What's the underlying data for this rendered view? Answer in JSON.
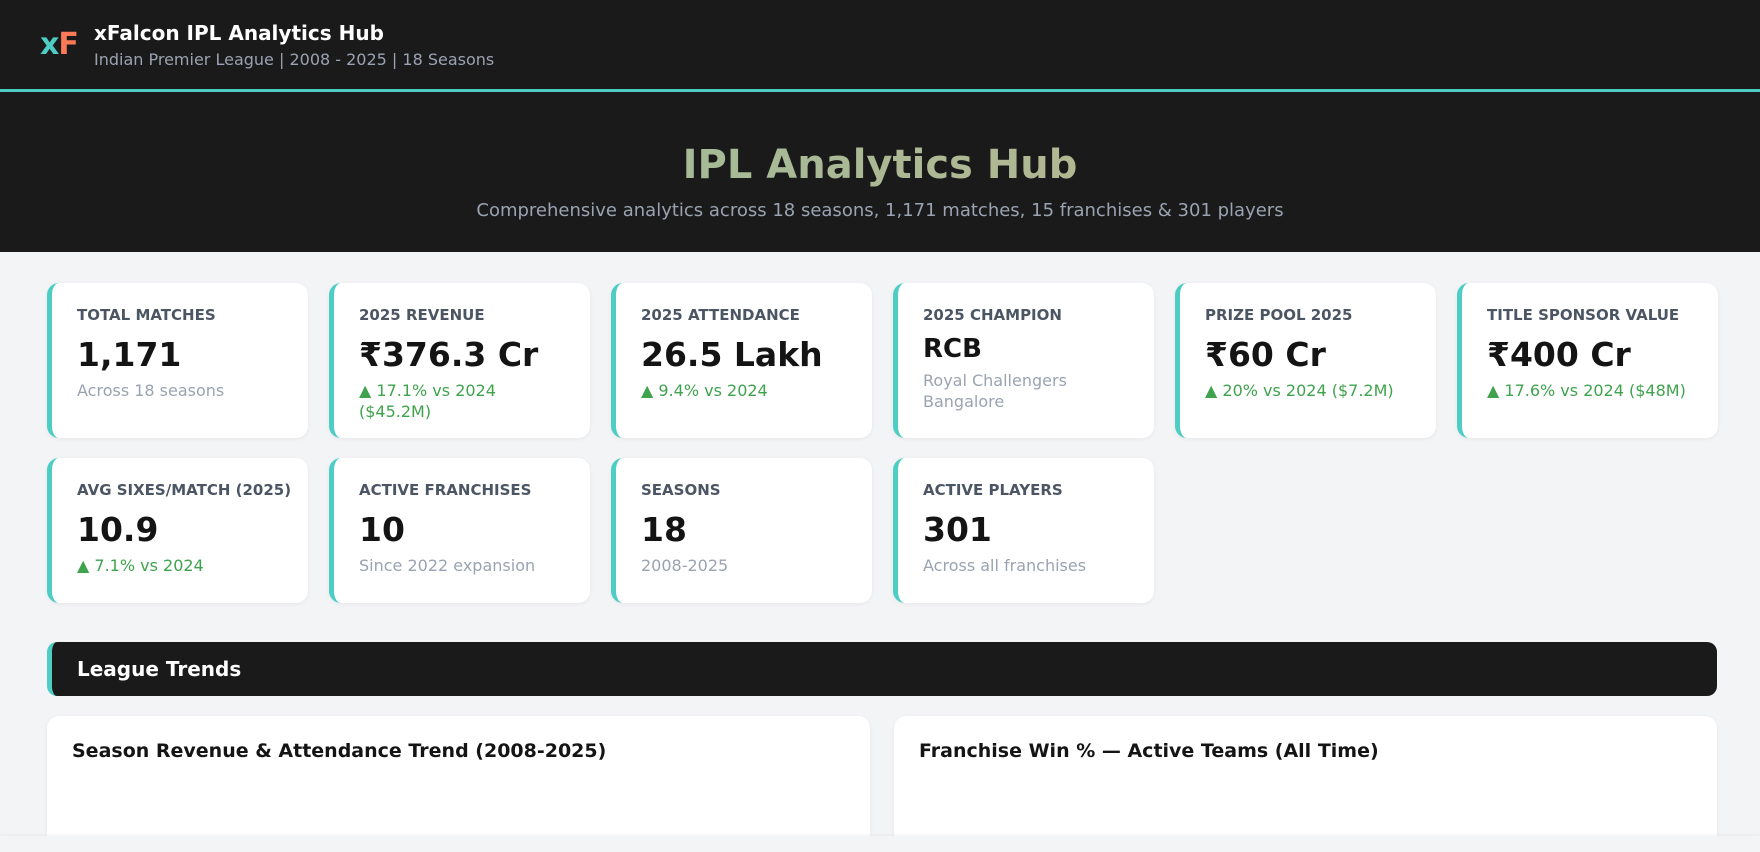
{
  "header": {
    "logo_x": "x",
    "logo_f": "F",
    "title": "xFalcon IPL Analytics Hub",
    "subtitle": "Indian Premier League | 2008 - 2025 | 18 Seasons"
  },
  "hero": {
    "title": "IPL Analytics Hub",
    "subtitle": "Comprehensive analytics across 18 seasons, 1,171 matches, 15 franchises & 301 players"
  },
  "stats": [
    {
      "label": "TOTAL MATCHES",
      "value": "1,171",
      "note": "Across 18 seasons"
    },
    {
      "label": "2025 REVENUE",
      "value": "₹376.3 Cr",
      "note": "▲ 17.1% vs 2024 ($45.2M)"
    },
    {
      "label": "2025 ATTENDANCE",
      "value": "26.5 Lakh",
      "note": "▲ 9.4% vs 2024"
    },
    {
      "label": "2025 CHAMPION",
      "value": "RCB",
      "note": "Royal Challengers Bangalore"
    },
    {
      "label": "PRIZE POOL 2025",
      "value": "₹60 Cr",
      "note": "▲ 20% vs 2024 ($7.2M)"
    },
    {
      "label": "TITLE SPONSOR VALUE",
      "value": "₹400 Cr",
      "note": "▲ 17.6% vs 2024 ($48M)"
    },
    {
      "label": "AVG SIXES/MATCH (2025)",
      "value": "10.9",
      "note": "▲ 7.1% vs 2024"
    },
    {
      "label": "ACTIVE FRANCHISES",
      "value": "10",
      "note": "Since 2022 expansion"
    },
    {
      "label": "SEASONS",
      "value": "18",
      "note": "2008-2025"
    },
    {
      "label": "ACTIVE PLAYERS",
      "value": "301",
      "note": "Across all franchises"
    }
  ],
  "section": {
    "title": "League Trends"
  },
  "panels": {
    "left_title": "Season Revenue & Attendance Trend (2008-2025)",
    "right_title": "Franchise Win % — Active Teams (All Time)"
  },
  "colors": {
    "accent": "#4ecdc4",
    "dark": "#1a1a1a",
    "positive": "#3fa34d",
    "logo_orange": "#ff7a59"
  }
}
